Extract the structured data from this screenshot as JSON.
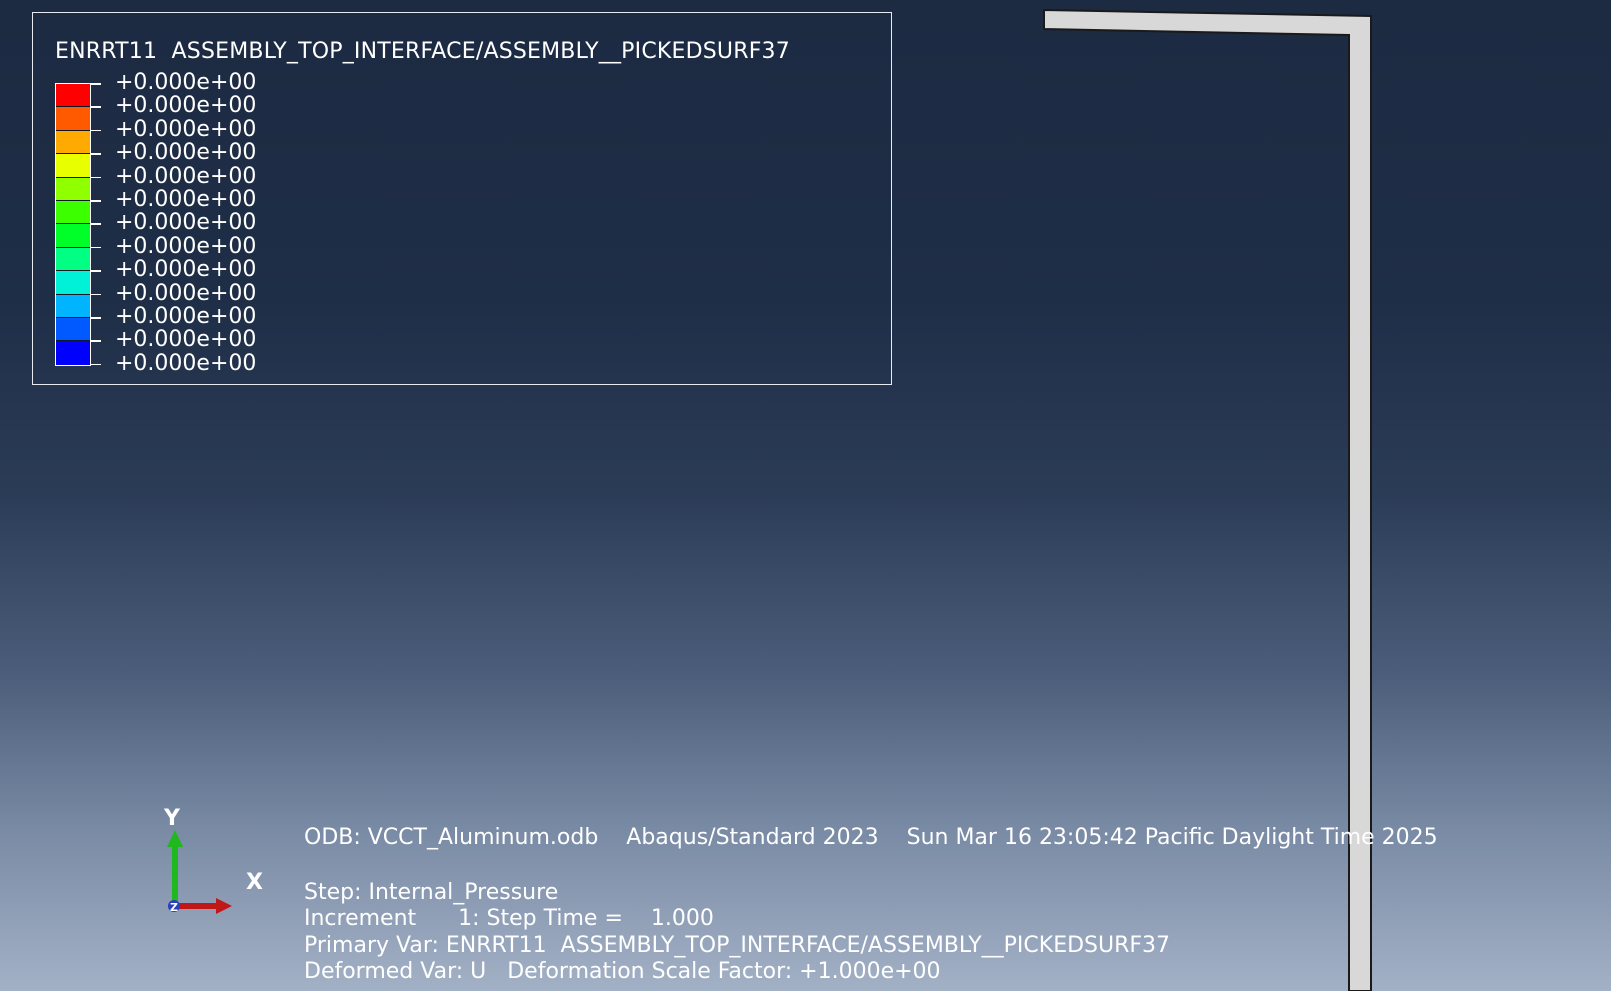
{
  "legend": {
    "title": "ENRRT11  ASSEMBLY_TOP_INTERFACE/ASSEMBLY__PICKEDSURF37",
    "colors": [
      "#ff0000",
      "#ff5a00",
      "#ffaa00",
      "#e8ff00",
      "#90ff00",
      "#3cff00",
      "#00ff28",
      "#00ff82",
      "#00f0d8",
      "#00b4ff",
      "#005aff",
      "#0000ff"
    ],
    "values": [
      "+0.000e+00",
      "+0.000e+00",
      "+0.000e+00",
      "+0.000e+00",
      "+0.000e+00",
      "+0.000e+00",
      "+0.000e+00",
      "+0.000e+00",
      "+0.000e+00",
      "+0.000e+00",
      "+0.000e+00",
      "+0.000e+00",
      "+0.000e+00"
    ]
  },
  "triad": {
    "y_label": "Y",
    "x_label": "X",
    "z_label": "Z",
    "y_color": "#1fb81f",
    "x_color": "#c01818",
    "z_color": "#2a3ec0"
  },
  "info": {
    "odb_line": "ODB: VCCT_Aluminum.odb    Abaqus/Standard 2023    Sun Mar 16 23:05:42 Pacific Daylight Time 2025",
    "step_line": "Step: Internal_Pressure",
    "increment_line": "Increment      1: Step Time =    1.000",
    "primary_var_line": "Primary Var: ENRRT11  ASSEMBLY_TOP_INTERFACE/ASSEMBLY__PICKEDSURF37",
    "deformed_var_line": "Deformed Var: U   Deformation Scale Factor: +1.000e+00"
  },
  "model": {
    "part_fill": "#d8d8d8",
    "part_edge": "#1a1a1a"
  }
}
